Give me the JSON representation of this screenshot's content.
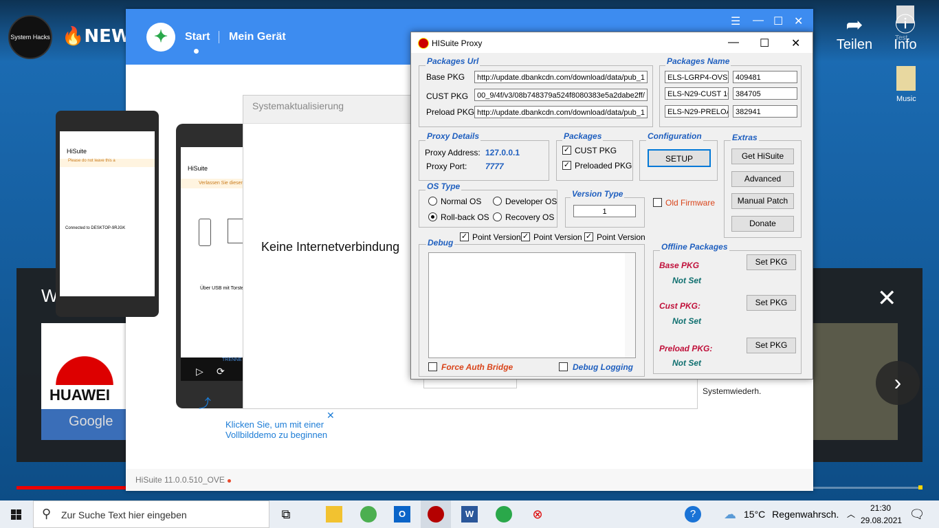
{
  "video": {
    "channel": "System Hacks",
    "title": "🔥NEW!",
    "share_label": "Teilen",
    "info_label": "Info",
    "more_videos": "Weitere Vi",
    "huawei_label": "HUAWEI",
    "google_label": "Google",
    "desktop_icons": [
      "Test",
      "Music"
    ]
  },
  "hisuite": {
    "tab_start": "Start",
    "tab_device": "Mein Gerät",
    "dialog_title": "Systemaktualisierung",
    "no_internet": "Keine Internetverbindung",
    "system_restore": "Systemwiederh.",
    "hint": "Klicken Sie, um mit einer Vollbilddemo zu beginnen",
    "footer_version": "HiSuite 11.0.0.510_OVE",
    "phone_app": "HiSuite",
    "phone_warning": "Verlassen Sie dieser",
    "phone_usb": "Über USB mit Torste",
    "phone_disconnect": "TRENNE",
    "phone2_app": "HiSuite",
    "phone2_warning": "Please do not leave this a",
    "phone2_connected": "Connected to DESKTOP-9RJGK"
  },
  "proxy": {
    "title": "HISuite Proxy",
    "packages_url": {
      "title": "Packages Url",
      "base_label": "Base PKG",
      "base_value": "http://update.dbankcdn.com/download/data/pub_1",
      "cust_label": "CUST PKG",
      "cust_value": "00_9/4f/v3/08b748379a524f8080383e5a2dabe2ff/",
      "preload_label": "Preload PKG",
      "preload_value": "http://update.dbankcdn.com/download/data/pub_1"
    },
    "packages_name": {
      "title": "Packages Name",
      "rows": [
        {
          "name": "ELS-LGRP4-OVS",
          "id": "409481"
        },
        {
          "name": "ELS-N29-CUST 10",
          "id": "384705"
        },
        {
          "name": "ELS-N29-PRELOA",
          "id": "382941"
        }
      ]
    },
    "proxy_details": {
      "title": "Proxy Details",
      "address_label": "Proxy Address:",
      "address_value": "127.0.0.1",
      "port_label": "Proxy Port:",
      "port_value": "7777"
    },
    "packages": {
      "title": "Packages",
      "cust_label": "CUST PKG",
      "preloaded_label": "Preloaded PKG"
    },
    "configuration": {
      "title": "Configuration",
      "setup_label": "SETUP"
    },
    "extras": {
      "title": "Extras",
      "get_hisuite": "Get HiSuite",
      "advanced": "Advanced",
      "manual_patch": "Manual Patch",
      "donate": "Donate"
    },
    "os_type": {
      "title": "OS Type",
      "normal": "Normal OS",
      "developer": "Developer OS",
      "rollback": "Roll-back OS",
      "recovery": "Recovery OS",
      "selected": "Roll-back OS"
    },
    "version_type": {
      "title": "Version Type",
      "value": "1"
    },
    "old_firmware": "Old Firmware",
    "point_version": "Point Version",
    "debug": {
      "title": "Debug",
      "force_auth": "Force Auth Bridge",
      "debug_logging": "Debug Logging"
    },
    "offline": {
      "title": "Offline Packages",
      "base_label": "Base PKG",
      "base_status": "Not Set",
      "cust_label": "Cust PKG:",
      "cust_status": "Not Set",
      "preload_label": "Preload PKG:",
      "preload_status": "Not Set",
      "set_pkg": "Set PKG"
    }
  },
  "taskbar": {
    "search_placeholder": "Zur Suche Text hier eingeben",
    "temperature": "15°C",
    "weather": "Regenwahrsch.",
    "time": "21:30",
    "date": "29.08.2021"
  }
}
